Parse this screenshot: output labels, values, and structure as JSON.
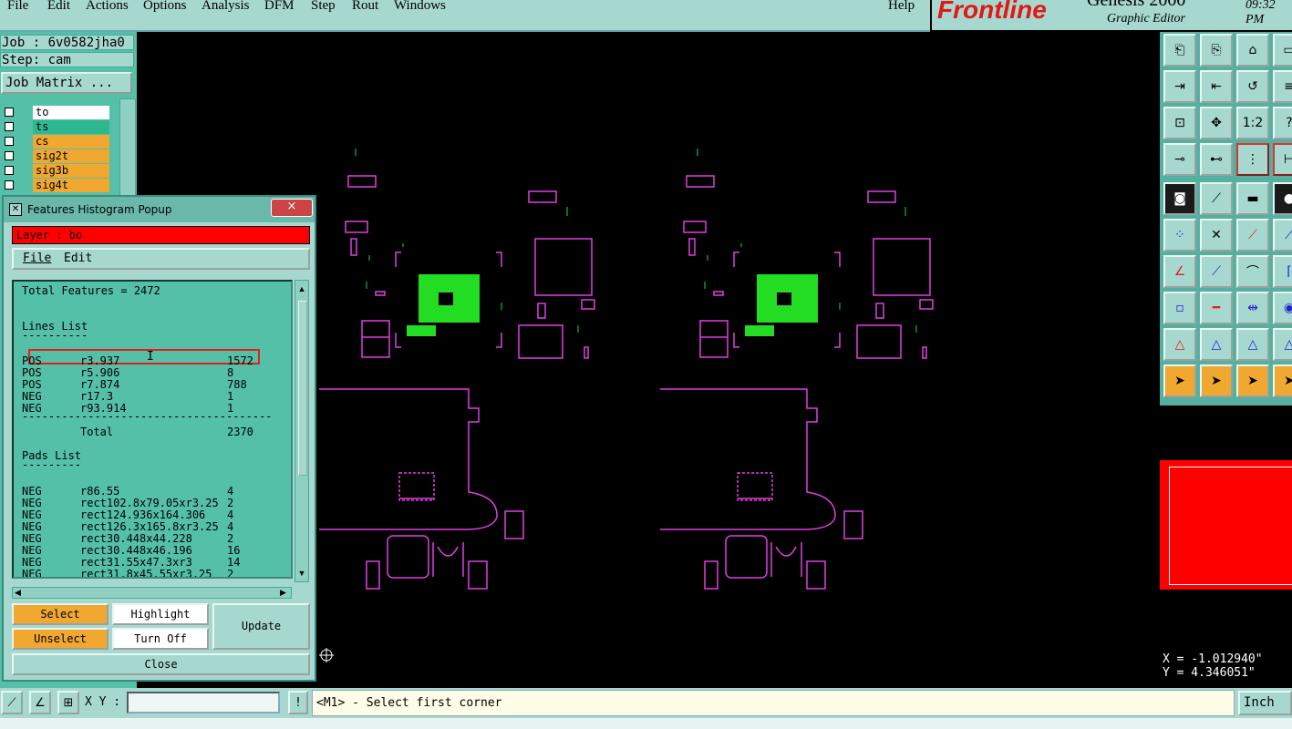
{
  "menubar": {
    "items": [
      "File",
      "Edit",
      "Actions",
      "Options",
      "Analysis",
      "DFM",
      "Step",
      "Rout",
      "Windows"
    ],
    "help": "Help"
  },
  "brand": {
    "logo": "Frontline",
    "product": "Genesis 2000",
    "subtitle": "Graphic Editor",
    "time": "09:32 PM"
  },
  "job": {
    "label": "Job : 6v0582jha0",
    "step": "Step: cam",
    "matrix_button": "Job Matrix ..."
  },
  "layers": [
    {
      "name": "to",
      "color": "#ffffff"
    },
    {
      "name": "ts",
      "color": "#2fb890"
    },
    {
      "name": "cs",
      "color": "#f0a830"
    },
    {
      "name": "sig2t",
      "color": "#f0a830"
    },
    {
      "name": "sig3b",
      "color": "#f0a830"
    },
    {
      "name": "sig4t",
      "color": "#f0a830"
    }
  ],
  "popup": {
    "title": "Features Histogram Popup",
    "close_x": "×",
    "layer": "Layer :  bo",
    "menu": [
      "File",
      "Edit"
    ],
    "total": "Total Features = 2472",
    "lines_header": "Lines List",
    "lines_underline": "----------",
    "lines": [
      {
        "pol": "POS",
        "sym": "r3.937",
        "count": "1572"
      },
      {
        "pol": "POS",
        "sym": "r5.906",
        "count": "8"
      },
      {
        "pol": "POS",
        "sym": "r7.874",
        "count": "788"
      },
      {
        "pol": "NEG",
        "sym": "r17.3",
        "count": "1"
      },
      {
        "pol": "NEG",
        "sym": "r93.914",
        "count": "1"
      }
    ],
    "lines_sep": "--------------------------------------",
    "lines_total_label": "Total",
    "lines_total": "2370",
    "pads_header": "Pads List",
    "pads_underline": "---------",
    "pads": [
      {
        "pol": "NEG",
        "sym": "r86.55",
        "count": "4"
      },
      {
        "pol": "NEG",
        "sym": "rect102.8x79.05xr3.25",
        "count": "2"
      },
      {
        "pol": "NEG",
        "sym": "rect124.936x164.306",
        "count": "4"
      },
      {
        "pol": "NEG",
        "sym": "rect126.3x165.8xr3.25",
        "count": "4"
      },
      {
        "pol": "NEG",
        "sym": "rect30.448x44.228",
        "count": "2"
      },
      {
        "pol": "NEG",
        "sym": "rect30.448x46.196",
        "count": "16"
      },
      {
        "pol": "NEG",
        "sym": "rect31.55x47.3xr3",
        "count": "14"
      },
      {
        "pol": "NEG",
        "sym": "rect31.8x45.55xr3.25",
        "count": "2"
      }
    ],
    "buttons": {
      "select": "Select",
      "highlight": "Highlight",
      "unselect": "Unselect",
      "turn_off": "Turn Off",
      "update": "Update",
      "close": "Close"
    }
  },
  "coords": {
    "x": "X = -1.012940\"",
    "y": "Y = 4.346051\""
  },
  "status": {
    "xy_label": "X Y :",
    "xy_value": "",
    "message": "<M1> - Select first corner",
    "units": "Inch"
  },
  "colors": {
    "panel": "#a7d8d0",
    "accent_green": "#55c0a8",
    "highlight": "#ff0000",
    "outline": "#e040e0",
    "copper": "#22dd22"
  }
}
